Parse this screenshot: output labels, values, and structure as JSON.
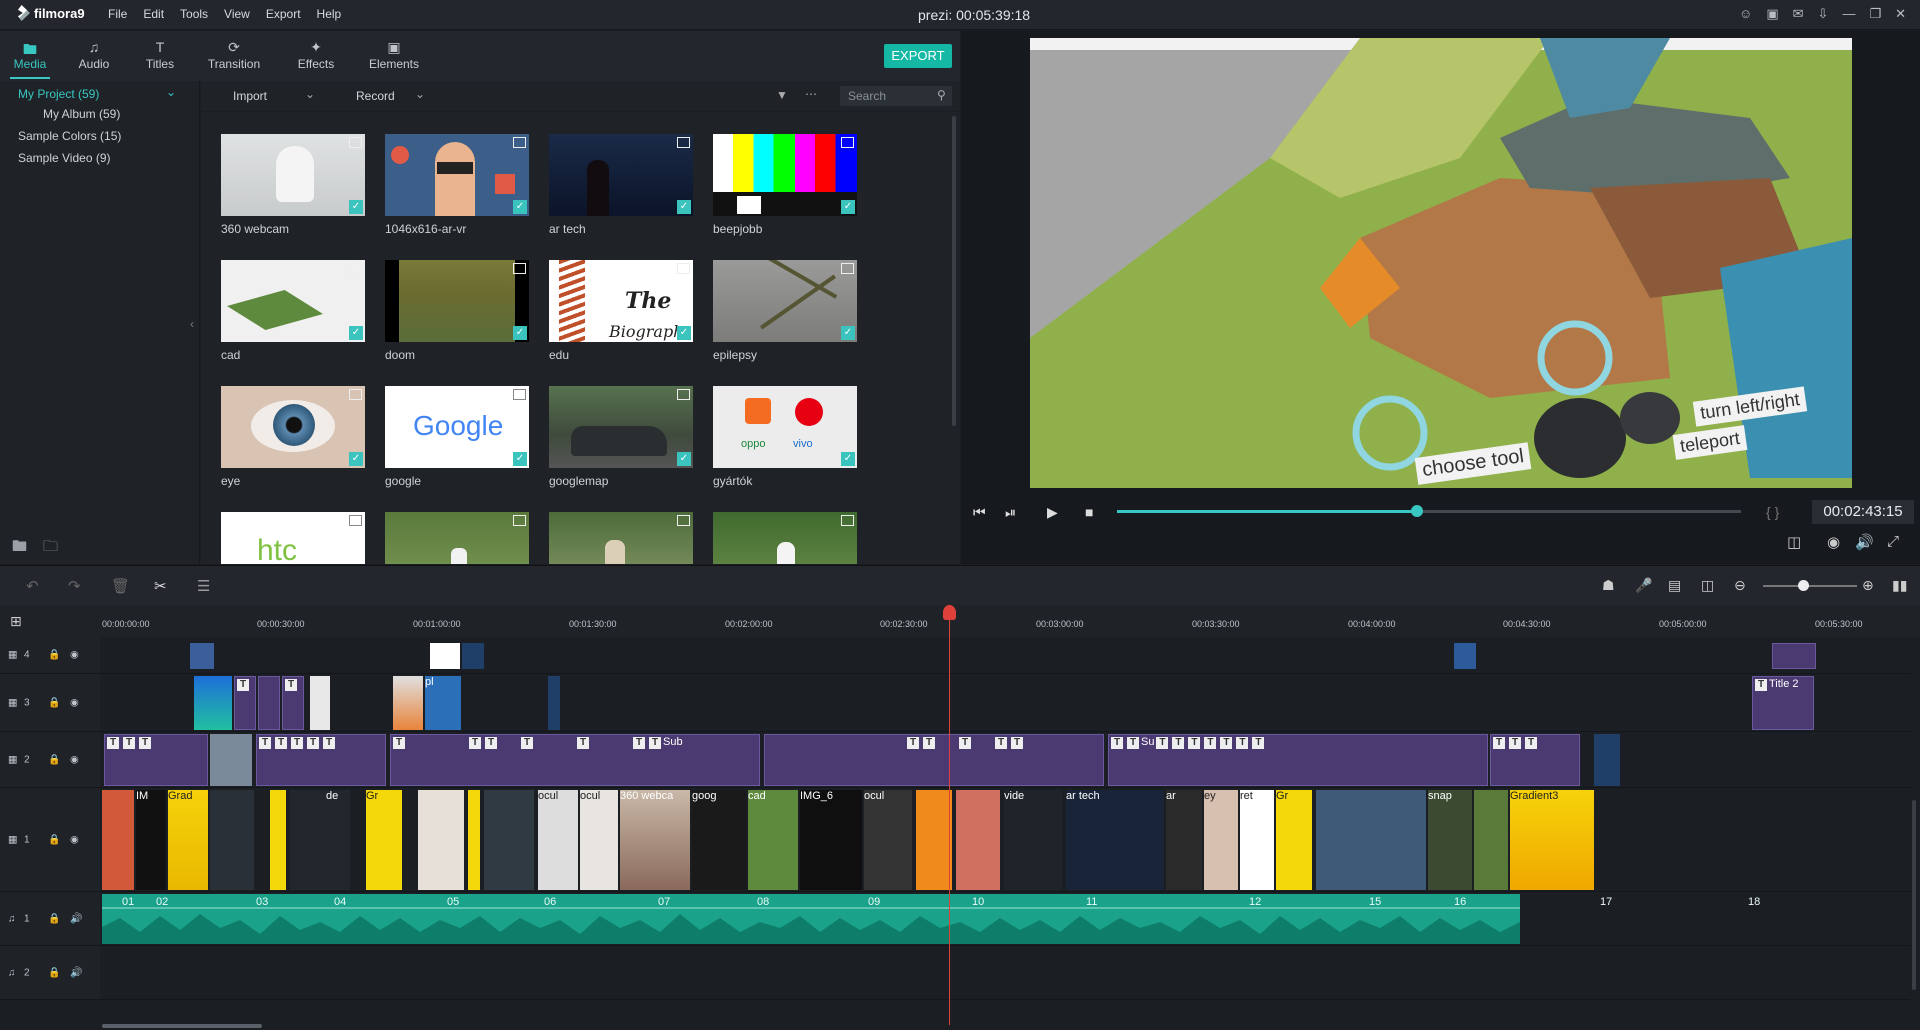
{
  "app": {
    "name": "filmora9",
    "project_title": "prezi: 00:05:39:18"
  },
  "menu": [
    "File",
    "Edit",
    "Tools",
    "View",
    "Export",
    "Help"
  ],
  "media_tabs": [
    {
      "label": "Media",
      "icon": "folder-icon"
    },
    {
      "label": "Audio",
      "icon": "music-note-icon"
    },
    {
      "label": "Titles",
      "icon": "text-icon"
    },
    {
      "label": "Transition",
      "icon": "transition-icon"
    },
    {
      "label": "Effects",
      "icon": "effects-icon"
    },
    {
      "label": "Elements",
      "icon": "image-icon"
    }
  ],
  "export_label": "EXPORT",
  "sidebar": {
    "items": [
      "My Project (59)",
      "My Album (59)",
      "Sample Colors (15)",
      "Sample Video (9)"
    ]
  },
  "media_toolbar": {
    "import": "Import",
    "record": "Record",
    "search_placeholder": "Search"
  },
  "media_items": [
    {
      "label": "360 webcam",
      "type": "video"
    },
    {
      "label": "1046x616-ar-vr",
      "type": "image"
    },
    {
      "label": "ar tech",
      "type": "video"
    },
    {
      "label": "beepjobb",
      "type": "image"
    },
    {
      "label": "cad",
      "type": "video"
    },
    {
      "label": "doom",
      "type": "video"
    },
    {
      "label": "edu",
      "type": "video"
    },
    {
      "label": "epilepsy",
      "type": "video"
    },
    {
      "label": "eye",
      "type": "image"
    },
    {
      "label": "google",
      "type": "image"
    },
    {
      "label": "googlemap",
      "type": "image"
    },
    {
      "label": "gyártók",
      "type": "image"
    },
    {
      "label": "",
      "type": "image"
    },
    {
      "label": "",
      "type": "video"
    },
    {
      "label": "",
      "type": "video"
    },
    {
      "label": "",
      "type": "video"
    }
  ],
  "thumb_text": {
    "google": "Google",
    "htc": "htc",
    "edu_title": "The",
    "edu_sub": "Biograph"
  },
  "preview": {
    "timecode": "00:02:43:15",
    "progress": 0.48,
    "overlay_labels": [
      "turn left/right",
      "teleport",
      "choose tool"
    ]
  },
  "ruler_ticks": [
    "00:00:00:00",
    "00:00:30:00",
    "00:01:00:00",
    "00:01:30:00",
    "00:02:00:00",
    "00:02:30:00",
    "00:03:00:00",
    "00:03:30:00",
    "00:04:00:00",
    "00:04:30:00",
    "00:05:00:00",
    "00:05:30:00"
  ],
  "tracks": {
    "video": [
      {
        "name": "4"
      },
      {
        "name": "3"
      },
      {
        "name": "2"
      },
      {
        "name": "1"
      }
    ],
    "audio": [
      {
        "name": "1"
      },
      {
        "name": "2"
      }
    ]
  },
  "clip_labels": {
    "title2": "Title 2",
    "sub1": "Sub",
    "su1": "Su",
    "grad": "Grad",
    "gradient3": "Gradient3",
    "img6": "IMG_6",
    "art": "ar tech",
    "webca": "360 webca",
    "goog": "goog",
    "cad": "cad",
    "ocul": "ocul",
    "vide": "vide",
    "snap": "snap",
    "im": "IM",
    "ar": "ar",
    "ey": "ey",
    "ret": "ret",
    "gr": "Gr",
    "de": "de",
    "pl": "pl"
  },
  "audio_markers": [
    "01",
    "02",
    "03",
    "04",
    "05",
    "06",
    "07",
    "08",
    "09",
    "10",
    "11",
    "12",
    "15",
    "16",
    "17",
    "18"
  ],
  "colors": {
    "accent": "#38c7c1",
    "export": "#14b8a5",
    "title_clip": "#4b3a72",
    "video_clip": "#1f3f68",
    "audio_clip": "#1aa38a",
    "playhead": "#e0403a"
  }
}
